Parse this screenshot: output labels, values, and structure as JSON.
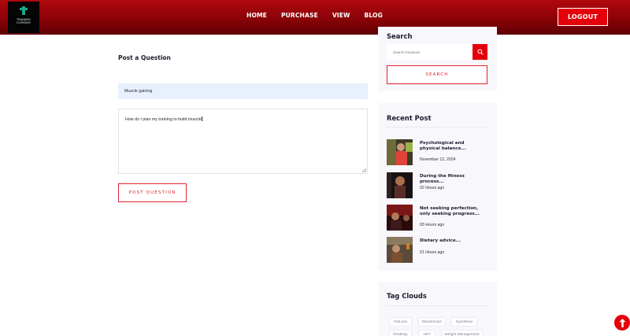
{
  "brand": {
    "logo_text": "TRAINING\nCOMPANY"
  },
  "nav": {
    "items": [
      "HOME",
      "PURCHASE",
      "VIEW",
      "BLOG"
    ],
    "logout_label": "LOGOUT"
  },
  "question_form": {
    "title": "Post a Question",
    "subject_value": "Muscle gaining",
    "message_value": "How do I plan my training to build muscle",
    "submit_label": "POST QUESTION"
  },
  "search": {
    "title": "Search",
    "placeholder": "Search Keyword",
    "button_label": "SEARCH"
  },
  "recent_posts": {
    "title": "Recent Post",
    "items": [
      {
        "title": "Psychological and physical balance...",
        "date": "November 12, 2024"
      },
      {
        "title": "During the fitness process...",
        "date": "02 Hours ago"
      },
      {
        "title": "Not seeking perfection, only seeking progress...",
        "date": "03 Hours ago"
      },
      {
        "title": "Dietary advice...",
        "date": "01 Hours ago"
      }
    ]
  },
  "tag_clouds": {
    "title": "Tag Clouds",
    "tags": [
      "FatLoss",
      "MuscleGain",
      "GymWear",
      "RestDay",
      "HIIT",
      "Weight Management"
    ]
  },
  "colors": {
    "accent": "#e4000b",
    "header_dark": "#5e0003",
    "input_bg": "#e8f0fd",
    "sidebar_bg": "#f8f7fc"
  }
}
